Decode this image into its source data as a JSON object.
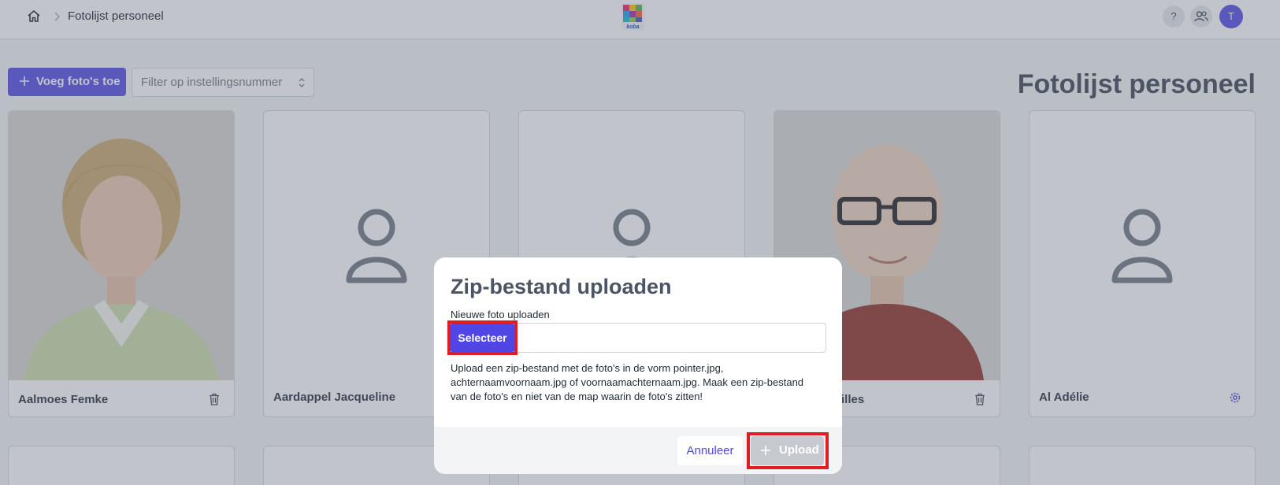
{
  "header": {
    "breadcrumb_title": "Fotolijst personeel",
    "logo_text": "koba",
    "help_label": "?",
    "avatar_initial": "T"
  },
  "toolbar": {
    "add_button_label": "Voeg foto's toe",
    "filter_placeholder": "Filter op instellingsnummer",
    "page_title": "Fotolijst personeel"
  },
  "cards": [
    {
      "name": "Aalmoes Femke",
      "has_photo": true,
      "action_icon": "trash-icon"
    },
    {
      "name": "Aardappel Jacqueline",
      "has_photo": false,
      "action_icon": ""
    },
    {
      "name": "",
      "has_photo": false,
      "action_icon": ""
    },
    {
      "name": "illes",
      "has_photo": true,
      "action_icon": "trash-icon"
    },
    {
      "name": "Al Adélie",
      "has_photo": false,
      "action_icon": "gear-icon"
    }
  ],
  "modal": {
    "title": "Zip-bestand uploaden",
    "field_label": "Nieuwe foto uploaden",
    "select_button_label": "Selecteer",
    "help_text": "Upload een zip-bestand met de foto's in de vorm pointer.jpg, achternaamvoornaam.jpg of voornaamachternaam.jpg. Maak een zip-bestand van de foto's en niet van de map waarin de foto's zitten!",
    "cancel_button_label": "Annuleer",
    "upload_button_label": "Upload"
  },
  "colors": {
    "accent": "#4f46e5",
    "highlight": "#e11d21",
    "overlay": "rgba(107,114,128,0.42)"
  }
}
